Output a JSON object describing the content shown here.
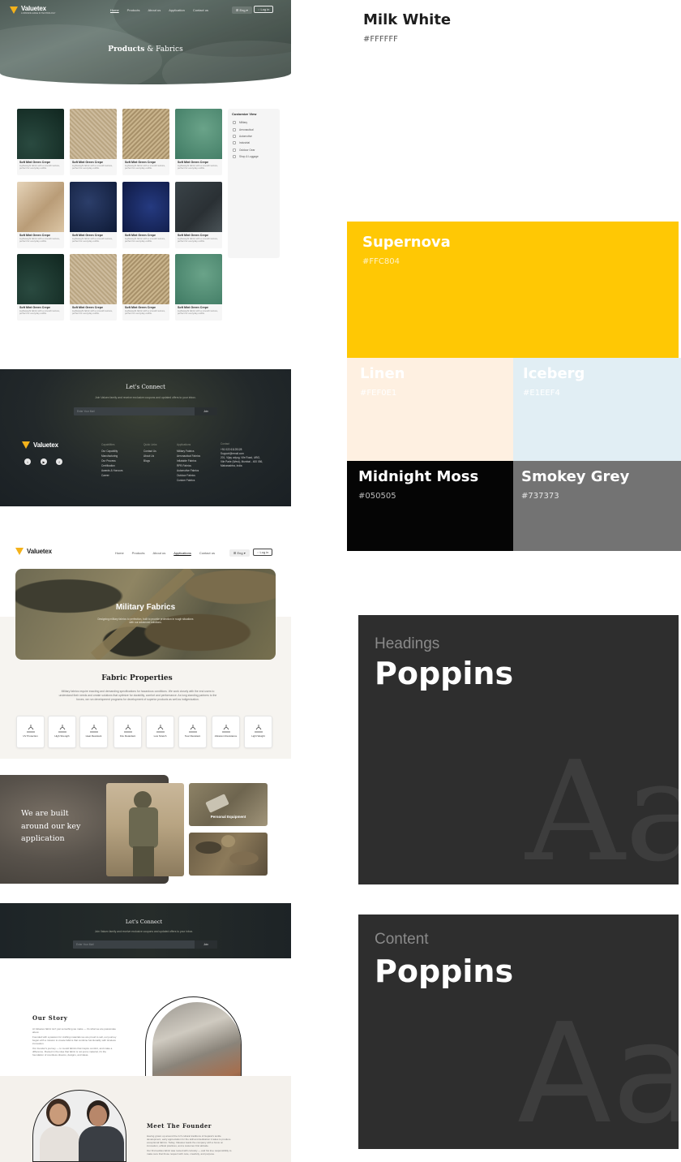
{
  "mock1": {
    "brand": "Valuetex",
    "brand_tagline": "A WINNING EDGE IN TECHNOLOGY",
    "nav": [
      "Home",
      "Products",
      "About us",
      "Application",
      "Contact us"
    ],
    "lang": "Eng",
    "login": "Log in",
    "hero_title_strong": "Products",
    "hero_title_rest": " & Fabrics",
    "products": [
      {
        "title": "Soft Mint Green Crepe",
        "desc": "Lightweight fabric with a smooth texture, perfect for everyday outfits."
      },
      {
        "title": "Soft Mint Green Crepe",
        "desc": "Lightweight fabric with a smooth texture, perfect for everyday outfits."
      },
      {
        "title": "Soft Mint Green Crepe",
        "desc": "Lightweight fabric with a smooth texture, perfect for everyday outfits."
      },
      {
        "title": "Soft Mint Green Crepe",
        "desc": "Lightweight fabric with a smooth texture, perfect for everyday outfits."
      },
      {
        "title": "Soft Mint Green Crepe",
        "desc": "Lightweight fabric with a smooth texture, perfect for everyday outfits."
      },
      {
        "title": "Soft Mint Green Crepe",
        "desc": "Lightweight fabric with a smooth texture, perfect for everyday outfits."
      },
      {
        "title": "Soft Mint Green Crepe",
        "desc": "Lightweight fabric with a smooth texture, perfect for everyday outfits."
      },
      {
        "title": "Soft Mint Green Crepe",
        "desc": "Lightweight fabric with a smooth texture, perfect for everyday outfits."
      },
      {
        "title": "Soft Mint Green Crepe",
        "desc": "Lightweight fabric with a smooth texture, perfect for everyday outfits."
      },
      {
        "title": "Soft Mint Green Crepe",
        "desc": "Lightweight fabric with a smooth texture, perfect for everyday outfits."
      },
      {
        "title": "Soft Mint Green Crepe",
        "desc": "Lightweight fabric with a smooth texture, perfect for everyday outfits."
      },
      {
        "title": "Soft Mint Green Crepe",
        "desc": "Lightweight fabric with a smooth texture, perfect for everyday outfits."
      }
    ],
    "filter": {
      "title": "Customize View",
      "options": [
        "Military",
        "Aeronautical",
        "Automotive",
        "Industrial",
        "Outdoor Gear",
        "Shop & Luggage"
      ]
    },
    "footer": {
      "connect_title": "Let's Connect",
      "connect_sub": "Join Valuex family and receive exclusive coupons and updated offers to your inbox.",
      "email_placeholder": "Enter Your Mail",
      "join": "Join",
      "brand": "Valuetex",
      "cols": [
        {
          "head": "Capabilities",
          "items": [
            "Our Capability",
            "Manufacturing",
            "Our Process",
            "Certification",
            "Awards & Honours",
            "Career"
          ]
        },
        {
          "head": "Quick Links",
          "items": [
            "Contact Us",
            "About Us",
            "Blogs"
          ]
        },
        {
          "head": "Applications",
          "items": [
            "Military Fabrics",
            "Aeronautical Fabrics",
            "Inflatable Fabrics",
            "RPB Fabrics",
            "Automotive Fabrics",
            "Outdoor Fabrics",
            "Custom Fabrics"
          ]
        },
        {
          "head": "Contact",
          "items": [
            "+91 022 61125128",
            "Support@email.com",
            "201, Vijay udyog, Vile Road, 4/BG,",
            "Vile Parle (West), Mumbai - 400 056,",
            "Maharashtra, India"
          ]
        }
      ]
    }
  },
  "mock2": {
    "brand": "Valuetex",
    "nav": [
      "Home",
      "Products",
      "About us",
      "Applications",
      "Contact us"
    ],
    "lang": "Eng",
    "login": "Log in",
    "hero_title": "Military Fabrics",
    "hero_sub": "Designing military fabrics to perfection, built to provide protection in rough situations with our advanced solutions.",
    "props_title": "Fabric Properties",
    "props_text": "Military fabrics require exacting and demanding specifications for hazardous conditions. We work closely with the end users to understand their needs and create solutions that optimize for durability, comfort and performance. As long standing partners to the forces, we run development programs for development of superior products as well as indigenization.",
    "props": [
      "UV Protection",
      "High Strength",
      "Heat Resistant",
      "Fire Retardant",
      "Low Stretch",
      "Tear Resistant",
      "Abrasion Resistance",
      "Light Weight"
    ],
    "built_text": "We are built around our key application",
    "personal_equipment": "Personal Equipment",
    "connect_title": "Let's Connect",
    "connect_sub": "Join Valuex family and receive exclusive coupons and updated offers to your inbox.",
    "email_placeholder": "Enter Your Mail",
    "join": "Join",
    "story_title": "Our Story",
    "story_p1": "At Valuetex fabric isn't just something we make — it's what we are passionate about.",
    "story_p2": "Founded with a passion for crafting materials we are proud to sell, our journey began with a mission to create fabrics that combine functionality with timeless innovation.",
    "story_p3": "Our founder's journey — to mould fabrics that inspire comfort, and make a difference. Rooted in the idea that fabric is not just a material, it's the foundation of countless dreams, designs, and ideas.",
    "founder_title": "Meet The Founder",
    "founder_p1": "Having grown up around the rich cultural traditions of Gujarat's textile development, early appreciation for the skill and dedication it takes to produce exceptional fabrics. Today, Valuetex leads the company with a focus on innovation, ethical practices, and a customer-first attitude.",
    "founder_p2": "Our first textiles fabric was rooted with curiosity — and his true responsibility to make sure that those respect with care, creativity, and purpose."
  },
  "palette": {
    "milk": {
      "name": "Milk White",
      "hex": "#FFFFFF"
    },
    "supernova": {
      "name": "Supernova",
      "hex": "#FFC804"
    },
    "linen": {
      "name": "Linen",
      "hex": "#FEF0E1"
    },
    "iceberg": {
      "name": "Iceberg",
      "hex": "#E1EEF4"
    },
    "midnight": {
      "name": "Midnight Moss",
      "hex": "#050505"
    },
    "smokey": {
      "name": "Smokey Grey",
      "hex": "#737373"
    }
  },
  "fonts": {
    "headings_label": "Headings",
    "headings_font": "Poppins",
    "content_label": "Content",
    "content_font": "Poppins",
    "aa_text": "Aa"
  }
}
